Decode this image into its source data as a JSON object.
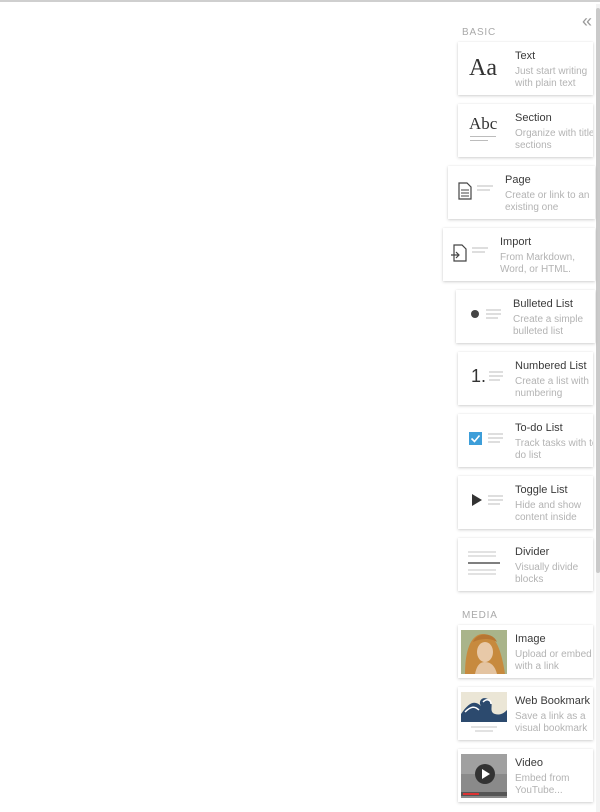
{
  "collapse_label": "«",
  "sections": {
    "basic": "BASIC",
    "media": "MEDIA"
  },
  "blocks": {
    "text": {
      "icon": "Aa",
      "title": "Text",
      "desc": "Just start writing with plain text"
    },
    "section": {
      "icon": "Abc",
      "title": "Section",
      "desc": "Organize with titled sections"
    },
    "page": {
      "title": "Page",
      "desc": "Create or link to an existing one"
    },
    "import": {
      "title": "Import",
      "desc": "From Markdown, Word, or HTML."
    },
    "bulleted": {
      "title": "Bulleted List",
      "desc": "Create a simple bulleted list"
    },
    "numbered": {
      "icon": "1.",
      "title": "Numbered List",
      "desc": "Create a list with numbering"
    },
    "todo": {
      "title": "To-do List",
      "desc": "Track tasks with to-do list"
    },
    "toggle": {
      "title": "Toggle List",
      "desc": "Hide and show content inside"
    },
    "divider": {
      "title": "Divider",
      "desc": "Visually divide blocks"
    },
    "image": {
      "title": "Image",
      "desc": "Upload or embed with a link"
    },
    "bookmark": {
      "title": "Web Bookmark",
      "desc": "Save a link as a visual bookmark"
    },
    "video": {
      "title": "Video",
      "desc": "Embed from YouTube..."
    }
  },
  "colors": {
    "checkbox": "#3d9ed9",
    "section_text": "#a9a9a9",
    "desc_text": "#b3b3b3"
  }
}
